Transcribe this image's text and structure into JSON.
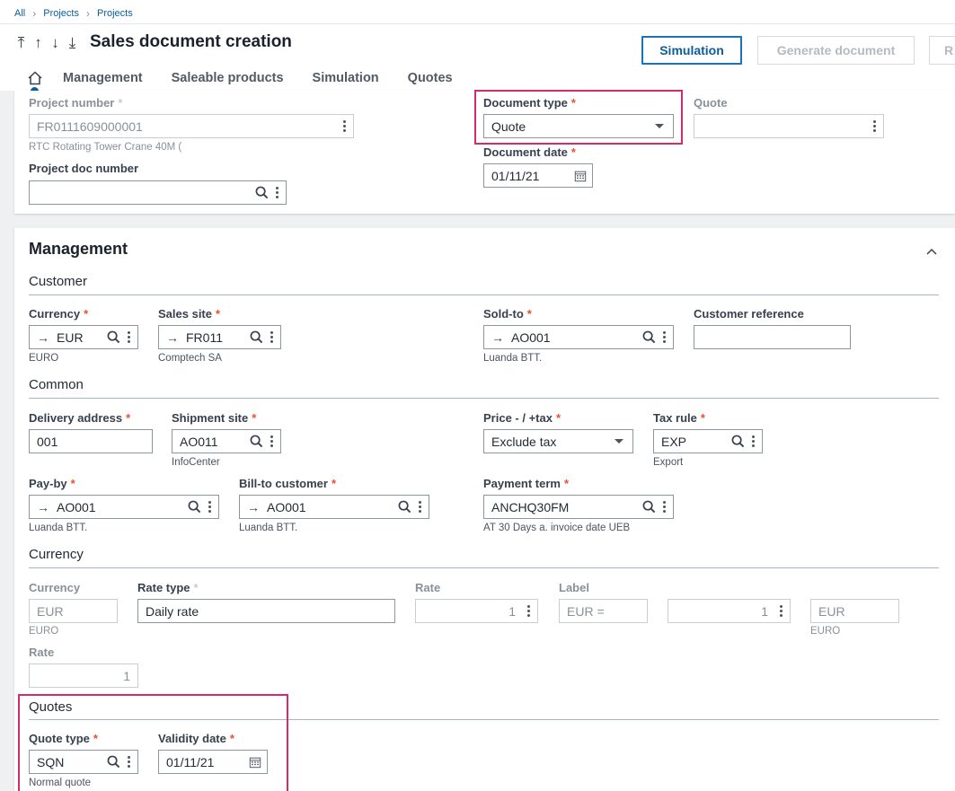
{
  "breadcrumb": [
    "All",
    "Projects",
    "Projects"
  ],
  "nav": {
    "first": "⤒",
    "up": "↑",
    "down": "↓",
    "last": "⤓"
  },
  "title": "Sales document creation",
  "buttons": {
    "simulation": "Simulation",
    "generate": "Generate document",
    "next": "R"
  },
  "tabs": [
    "Management",
    "Saleable products",
    "Simulation",
    "Quotes"
  ],
  "header": {
    "project_number": {
      "label": "Project number",
      "value": "FR0111609000001",
      "sub": "RTC Rotating Tower Crane 40M ("
    },
    "project_doc_number": {
      "label": "Project doc number",
      "value": ""
    },
    "document_type": {
      "label": "Document type",
      "value": "Quote"
    },
    "quote": {
      "label": "Quote",
      "value": ""
    },
    "document_date": {
      "label": "Document date",
      "value": "01/11/21"
    }
  },
  "management": {
    "title": "Management",
    "customer": {
      "title": "Customer",
      "currency": {
        "label": "Currency",
        "value": "EUR",
        "sub": "EURO"
      },
      "sales_site": {
        "label": "Sales site",
        "value": "FR011",
        "sub": "Comptech SA"
      },
      "sold_to": {
        "label": "Sold-to",
        "value": "AO001",
        "sub": "Luanda BTT."
      },
      "customer_reference": {
        "label": "Customer reference",
        "value": ""
      }
    },
    "common": {
      "title": "Common",
      "delivery_address": {
        "label": "Delivery address",
        "value": "001"
      },
      "shipment_site": {
        "label": "Shipment site",
        "value": "AO011",
        "sub": "InfoCenter"
      },
      "price_tax": {
        "label": "Price - / +tax",
        "value": "Exclude tax"
      },
      "tax_rule": {
        "label": "Tax rule",
        "value": "EXP",
        "sub": "Export"
      },
      "pay_by": {
        "label": "Pay-by",
        "value": "AO001",
        "sub": "Luanda BTT."
      },
      "bill_to": {
        "label": "Bill-to customer",
        "value": "AO001",
        "sub": "Luanda BTT."
      },
      "payment_term": {
        "label": "Payment term",
        "value": "ANCHQ30FM",
        "sub": "AT 30 Days a. invoice date UEB"
      }
    },
    "currency_section": {
      "title": "Currency",
      "currency": {
        "label": "Currency",
        "value": "EUR",
        "sub": "EURO"
      },
      "rate_type": {
        "label": "Rate type",
        "value": "Daily rate"
      },
      "rate": {
        "label": "Rate",
        "value": "1"
      },
      "label": {
        "label": "Label",
        "value": "EUR ="
      },
      "rate2": {
        "value": "1"
      },
      "currency2": {
        "value": "EUR",
        "sub": "EURO"
      },
      "rate3": {
        "label": "Rate",
        "value": "1"
      }
    },
    "quotes": {
      "title": "Quotes",
      "quote_type": {
        "label": "Quote type",
        "value": "SQN",
        "sub": "Normal quote"
      },
      "validity_date": {
        "label": "Validity date",
        "value": "01/11/21"
      }
    }
  },
  "colors": {
    "accent": "#0a5d9e",
    "required": "#e6522c",
    "highlight": "#d42b6f"
  }
}
